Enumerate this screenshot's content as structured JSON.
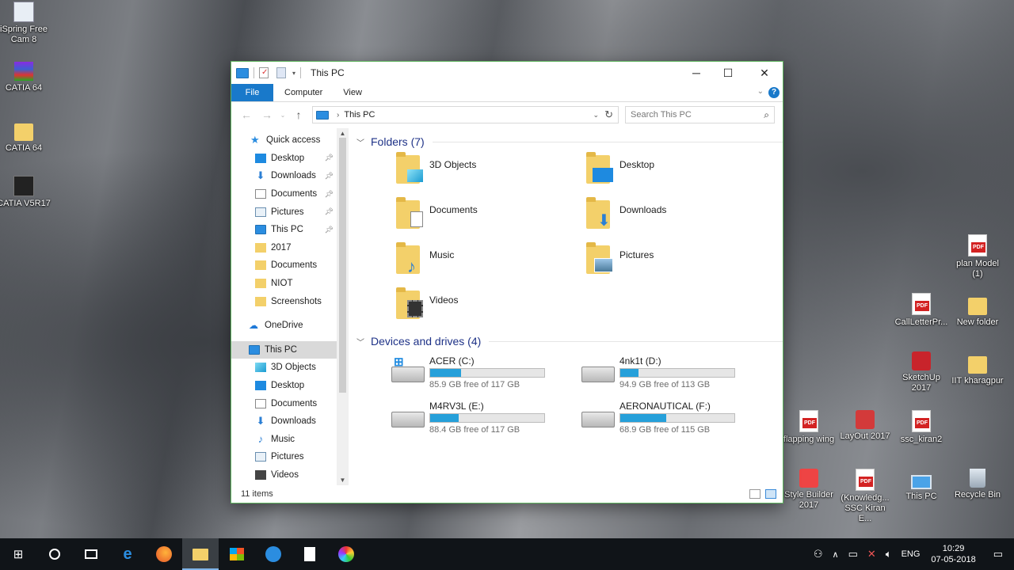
{
  "desktop": {
    "left_icons": [
      {
        "label": "iSpring Free Cam 8",
        "icon": "ispring-icon"
      },
      {
        "label": "CATIA 64",
        "icon": "winrar-icon"
      },
      {
        "label": "CATIA 64",
        "icon": "folder-icon"
      },
      {
        "label": "CATIA V5R17",
        "icon": "catia-icon"
      }
    ],
    "right_icons": [
      {
        "label": "plan Model (1)",
        "icon": "pdf-icon"
      },
      {
        "label": "CallLetterPr...",
        "icon": "pdf-icon"
      },
      {
        "label": "New folder",
        "icon": "folder-icon"
      },
      {
        "label": "SketchUp 2017",
        "icon": "sketchup-icon"
      },
      {
        "label": "IIT kharagpur",
        "icon": "folder-icon"
      },
      {
        "label": "flapping wing",
        "icon": "pdf-icon"
      },
      {
        "label": "LayOut 2017",
        "icon": "layout-icon"
      },
      {
        "label": "ssc_kiran2",
        "icon": "pdf-icon"
      },
      {
        "label": "Style Builder 2017",
        "icon": "stylebuilder-icon"
      },
      {
        "label": "(Knowledg... SSC Kiran E...",
        "icon": "pdf-icon"
      },
      {
        "label": "This PC",
        "icon": "this-pc-icon"
      },
      {
        "label": "Recycle Bin",
        "icon": "recycle-bin-icon"
      }
    ]
  },
  "window": {
    "title": "This PC",
    "ribbon_tabs": [
      "File",
      "Computer",
      "View"
    ],
    "address": {
      "crumb": "This PC"
    },
    "search": {
      "placeholder": "Search This PC"
    },
    "nav": {
      "quick_access": "Quick access",
      "quick_items": [
        {
          "label": "Desktop",
          "icon": "desktop",
          "pinned": true
        },
        {
          "label": "Downloads",
          "icon": "downloads",
          "pinned": true
        },
        {
          "label": "Documents",
          "icon": "documents",
          "pinned": true
        },
        {
          "label": "Pictures",
          "icon": "pictures",
          "pinned": true
        },
        {
          "label": "This PC",
          "icon": "pc",
          "pinned": true
        },
        {
          "label": "2017",
          "icon": "folder",
          "pinned": false
        },
        {
          "label": "Documents",
          "icon": "folder",
          "pinned": false
        },
        {
          "label": "NIOT",
          "icon": "folder",
          "pinned": false
        },
        {
          "label": "Screenshots",
          "icon": "folder",
          "pinned": false
        }
      ],
      "onedrive": "OneDrive",
      "this_pc": "This PC",
      "pc_items": [
        {
          "label": "3D Objects",
          "icon": "objects"
        },
        {
          "label": "Desktop",
          "icon": "desktop"
        },
        {
          "label": "Documents",
          "icon": "documents"
        },
        {
          "label": "Downloads",
          "icon": "downloads"
        },
        {
          "label": "Music",
          "icon": "music"
        },
        {
          "label": "Pictures",
          "icon": "pictures"
        },
        {
          "label": "Videos",
          "icon": "videos"
        }
      ]
    },
    "folders_header": "Folders (7)",
    "folders": [
      {
        "name": "3D Objects",
        "overlay": "objects"
      },
      {
        "name": "Desktop",
        "overlay": "desktop"
      },
      {
        "name": "Documents",
        "overlay": "documents"
      },
      {
        "name": "Downloads",
        "overlay": "downloads"
      },
      {
        "name": "Music",
        "overlay": "music"
      },
      {
        "name": "Pictures",
        "overlay": "pictures"
      },
      {
        "name": "Videos",
        "overlay": "videos"
      }
    ],
    "drives_header": "Devices and drives (4)",
    "drives": [
      {
        "name": "ACER (C:)",
        "free": "85.9 GB free of 117 GB",
        "used_fraction": 0.27,
        "system": true
      },
      {
        "name": "4nk1t (D:)",
        "free": "94.9 GB free of 113 GB",
        "used_fraction": 0.16,
        "system": false
      },
      {
        "name": "M4RV3L (E:)",
        "free": "88.4 GB free of 117 GB",
        "used_fraction": 0.25,
        "system": false
      },
      {
        "name": "AERONAUTICAL (F:)",
        "free": "68.9 GB free of 115 GB",
        "used_fraction": 0.4,
        "system": false
      }
    ],
    "status": "11 items"
  },
  "taskbar": {
    "clock_time": "10:29",
    "clock_date": "07-05-2018",
    "language": "ENG"
  },
  "colors": {
    "accent": "#1979ca",
    "drive_bar": "#26a0da",
    "group_header": "#1e3287"
  }
}
